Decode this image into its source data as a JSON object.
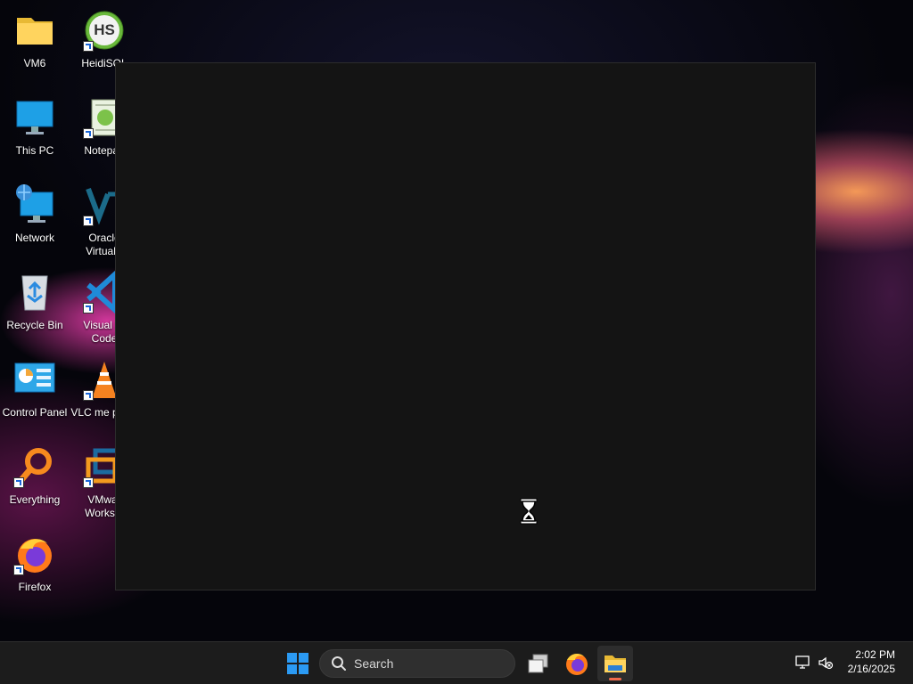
{
  "desktop": {
    "icons": [
      {
        "label": "VM6",
        "icon": "folder-icon"
      },
      {
        "label": "This PC",
        "icon": "monitor-icon"
      },
      {
        "label": "Network",
        "icon": "network-icon"
      },
      {
        "label": "Recycle Bin",
        "icon": "recycle-bin-icon"
      },
      {
        "label": "Control Panel",
        "icon": "control-panel-icon"
      },
      {
        "label": "Everything",
        "icon": "everything-search-icon"
      },
      {
        "label": "Firefox",
        "icon": "firefox-icon"
      },
      {
        "label": "HeidiSQL",
        "icon": "heidisql-icon",
        "badge": "HS"
      },
      {
        "label": "Notepad",
        "icon": "notepad-icon"
      },
      {
        "label": "Oracle VirtualB",
        "icon": "virtualbox-icon"
      },
      {
        "label": "Visual St Code",
        "icon": "vscode-icon"
      },
      {
        "label": "VLC me playe",
        "icon": "vlc-icon"
      },
      {
        "label": "VMwar Worksta",
        "icon": "vmware-icon"
      }
    ]
  },
  "window": {
    "state": "loading",
    "cursor": "hourglass-icon"
  },
  "taskbar": {
    "search_placeholder": "Search",
    "time": "2:02 PM",
    "date": "2/16/2025",
    "pinned": [
      "start-icon",
      "task-view-icon",
      "firefox-icon",
      "file-explorer-icon"
    ],
    "active_app": "file-explorer-icon"
  },
  "colors": {
    "accent": "#0078d4",
    "taskbar_bg": "#1c1c1c",
    "window_bg": "#141414"
  }
}
